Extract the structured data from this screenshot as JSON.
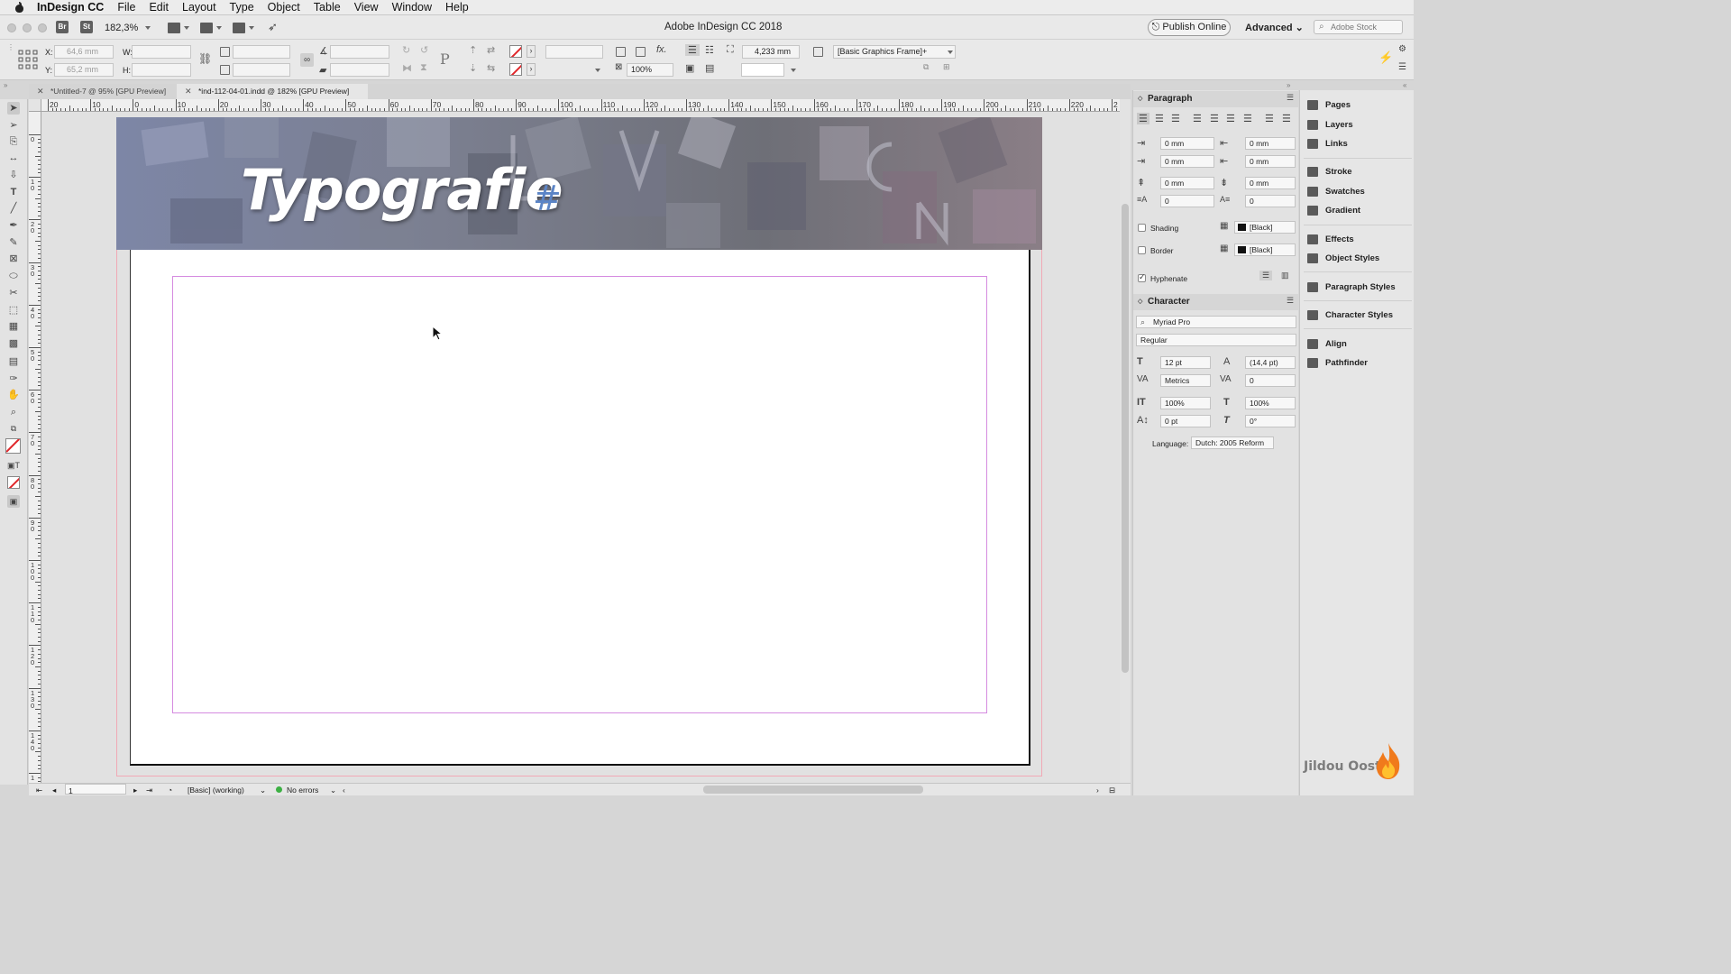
{
  "menubar": {
    "app_name": "InDesign CC",
    "items": [
      "File",
      "Edit",
      "Layout",
      "Type",
      "Object",
      "Table",
      "View",
      "Window",
      "Help"
    ]
  },
  "titlebar": {
    "zoom": "182,3%",
    "title": "Adobe InDesign CC 2018",
    "publish_label": "Publish Online",
    "workspace": "Advanced",
    "stock_placeholder": "Adobe Stock",
    "bridge_label": "Br",
    "stock_app_label": "St"
  },
  "control_panel": {
    "x_label": "X:",
    "x_value": "64,6 mm",
    "y_label": "Y:",
    "y_value": "65,2 mm",
    "w_label": "W:",
    "h_label": "H:",
    "scale_pct": "100%",
    "weight_value": "4,233 mm",
    "object_style": "[Basic Graphics Frame]+"
  },
  "tabs": [
    {
      "label": "*Untitled-7 @ 95% [GPU Preview]",
      "active": false
    },
    {
      "label": "*ind-112-04-01.indd @ 182% [GPU Preview]",
      "active": true
    }
  ],
  "ruler": {
    "h_ticks": [
      "20",
      "10",
      "0",
      "10",
      "20",
      "30",
      "40",
      "50",
      "60",
      "70",
      "80",
      "90",
      "100",
      "110",
      "120",
      "130",
      "140",
      "150",
      "160",
      "170",
      "180",
      "190",
      "200",
      "210",
      "220",
      "2"
    ],
    "v_ticks": [
      "0",
      "1 0",
      "2 0",
      "3 0",
      "4 0",
      "5 0",
      "6 0",
      "7 0",
      "8 0",
      "9 0",
      "1 0 0",
      "1 1 0",
      "1 2 0",
      "1 3 0",
      "1 4 0",
      "1"
    ]
  },
  "document": {
    "headline": "Typografie",
    "overset_marker": "#"
  },
  "statusbar": {
    "page": "1",
    "profile": "[Basic] (working)",
    "preflight": "No errors",
    "preflight_color": "#3cb043"
  },
  "paragraph_panel": {
    "title": "Paragraph",
    "left_indent": "0 mm",
    "right_indent": "0 mm",
    "first_line_indent": "0 mm",
    "last_line_indent": "0 mm",
    "space_before": "0 mm",
    "space_after": "0 mm",
    "drop_cap_lines": "0",
    "drop_cap_chars": "0",
    "shading_label": "Shading",
    "shading_swatch": "[Black]",
    "border_label": "Border",
    "border_swatch": "[Black]",
    "hyphenate_label": "Hyphenate",
    "hyphenate_checked": true
  },
  "character_panel": {
    "title": "Character",
    "font_family": "Myriad Pro",
    "font_style": "Regular",
    "font_size": "12 pt",
    "leading": "(14,4 pt)",
    "kerning": "Metrics",
    "tracking": "0",
    "vertical_scale": "100%",
    "horizontal_scale": "100%",
    "baseline_shift": "0 pt",
    "skew": "0°",
    "language_label": "Language:",
    "language": "Dutch: 2005 Reform"
  },
  "dock": {
    "group1": [
      "Pages",
      "Layers",
      "Links"
    ],
    "group2": [
      "Stroke",
      "Swatches",
      "Gradient"
    ],
    "group3": [
      "Effects",
      "Object Styles"
    ],
    "group4": [
      "Paragraph Styles"
    ],
    "group5": [
      "Character Styles"
    ],
    "group6": [
      "Align",
      "Pathfinder"
    ]
  },
  "watermark": "Jildou Oost",
  "colors": {
    "accent_red": "#e0262a",
    "margin_guide": "#d58be0",
    "bleed_guide": "#f1a9b5"
  }
}
